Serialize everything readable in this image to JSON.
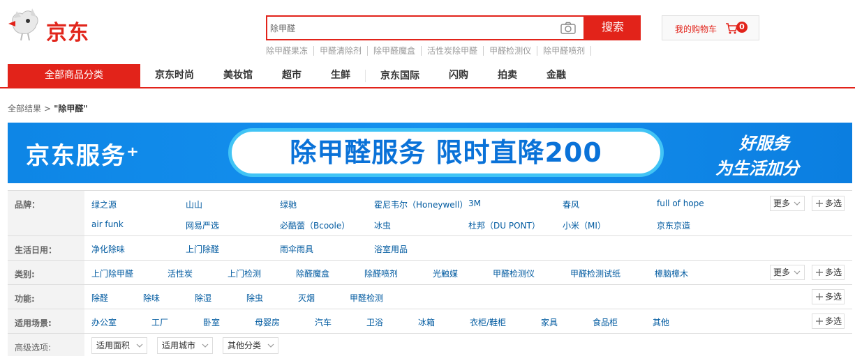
{
  "header": {
    "logo_text": "京东",
    "search_value": "除甲醛",
    "search_button": "搜索",
    "hotwords": [
      "除甲醛果冻",
      "甲醛清除剂",
      "除甲醛魔盒",
      "活性炭除甲醛",
      "甲醛检测仪",
      "除甲醛喷剂"
    ],
    "cart_label": "我的购物车",
    "cart_count": "0"
  },
  "nav": {
    "all_categories": "全部商品分类",
    "items": [
      "京东时尚",
      "美妆馆",
      "超市",
      "生鲜",
      "京东国际",
      "闪购",
      "拍卖",
      "金融"
    ]
  },
  "breadcrumb": {
    "root": "全部结果",
    "arrow": ">",
    "keyword": "\"除甲醛\""
  },
  "banner": {
    "left": "京东服务⁺",
    "center": "除甲醛服务 限时直降200",
    "right_line1": "好服务",
    "right_line2": "为生活加分"
  },
  "filters": {
    "brand": {
      "label": "品牌：",
      "values": [
        "绿之源",
        "山山",
        "绿驰",
        "霍尼韦尔（Honeywell）",
        "3M",
        "春风",
        "full of hope",
        "air funk",
        "网易严选",
        "必酷蕾（Bcoole）",
        "冰虫",
        "杜邦（DU PONT）",
        "小米（MI）",
        "京东京造"
      ]
    },
    "daily": {
      "label": "生活日用：",
      "values": [
        "净化除味",
        "上门除醛",
        "雨伞雨具",
        "浴室用品"
      ]
    },
    "category": {
      "label": "类别:",
      "values": [
        "上门除甲醛",
        "活性炭",
        "上门检测",
        "除醛魔盒",
        "除醛喷剂",
        "光触媒",
        "甲醛检测仪",
        "甲醛检测试纸",
        "樟脑樟木"
      ]
    },
    "function": {
      "label": "功能:",
      "values": [
        "除醛",
        "除味",
        "除湿",
        "除虫",
        "灭烟",
        "甲醛检测"
      ]
    },
    "scene": {
      "label": "适用场景:",
      "values": [
        "办公室",
        "工厂",
        "卧室",
        "母婴房",
        "汽车",
        "卫浴",
        "冰箱",
        "衣柜/鞋柜",
        "家具",
        "食品柜",
        "其他"
      ]
    },
    "advanced": {
      "label": "高级选项:",
      "selects": [
        "适用面积",
        "适用城市",
        "其他分类"
      ]
    },
    "more_label": "更多",
    "multi_label": "多选"
  },
  "colors": {
    "brand_red": "#e2231a",
    "link_blue": "#005aa0",
    "banner_blue": "#1591ef"
  }
}
